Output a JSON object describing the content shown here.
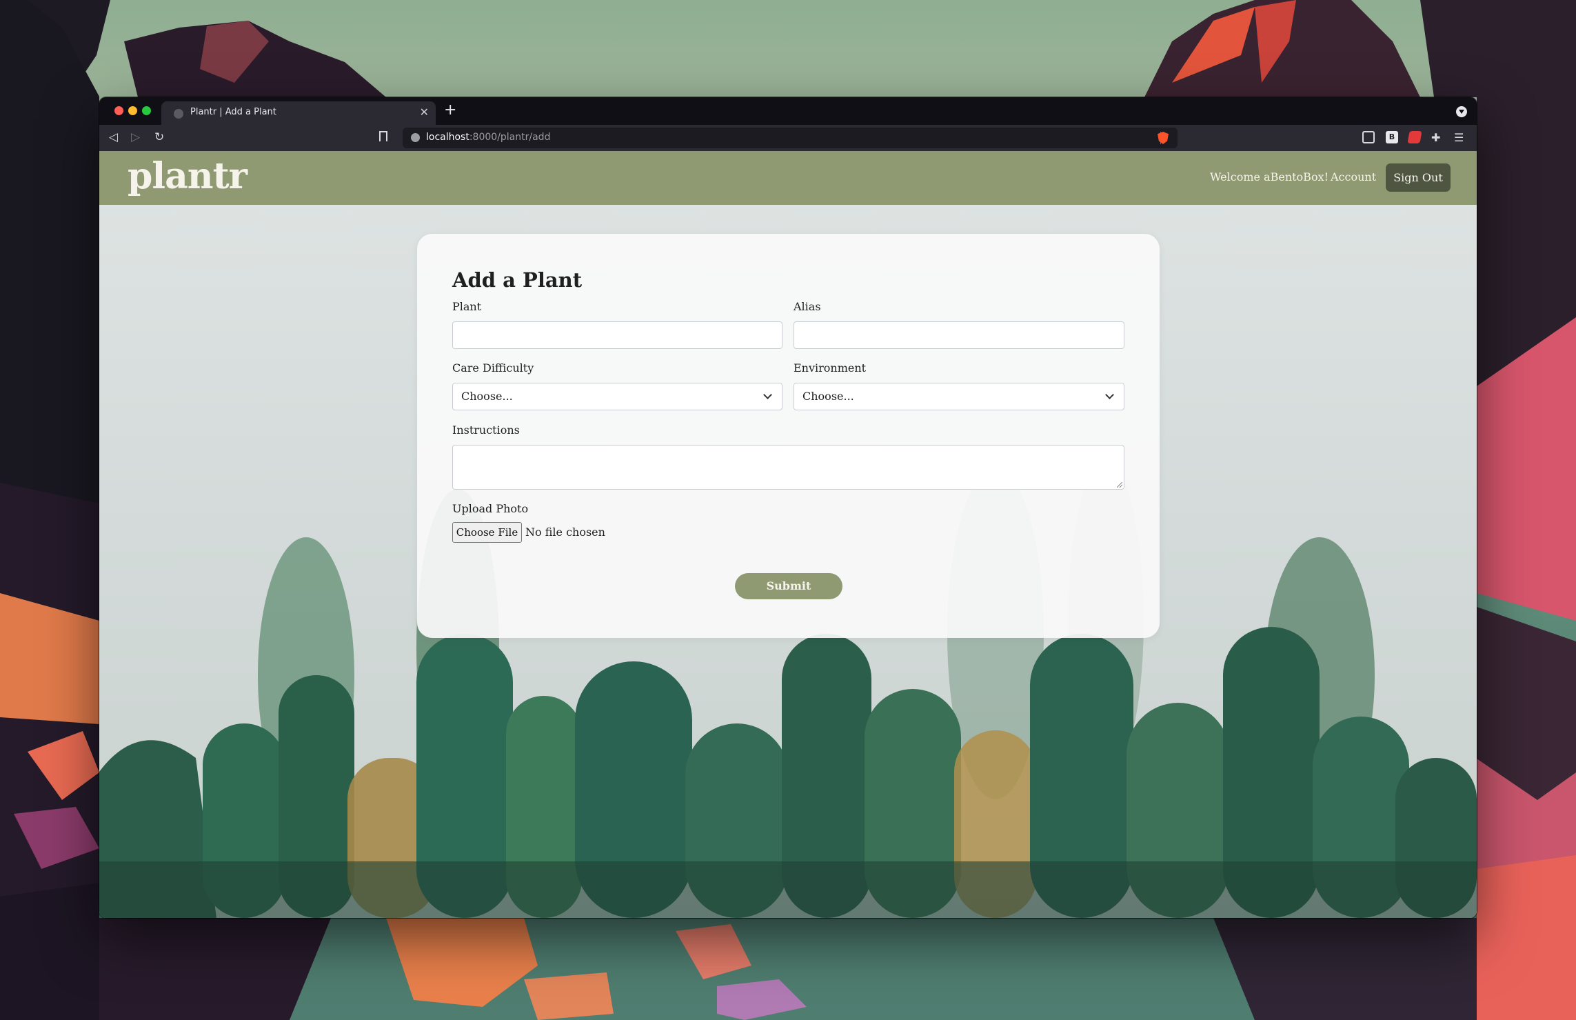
{
  "browser": {
    "tab_title": "Plantr | Add a Plant",
    "new_tab_label": "+",
    "url_host": "localhost",
    "url_path": ":8000/plantr/add",
    "extension_b_label": "B"
  },
  "navbar": {
    "brand": "plantr",
    "welcome": "Welcome aBentoBox!",
    "account": "Account",
    "sign_out": "Sign Out",
    "color": "#8f9a72"
  },
  "form": {
    "title": "Add a Plant",
    "plant_label": "Plant",
    "plant_value": "",
    "alias_label": "Alias",
    "alias_value": "",
    "care_difficulty_label": "Care Difficulty",
    "care_difficulty_value": "Choose...",
    "environment_label": "Environment",
    "environment_value": "Choose...",
    "instructions_label": "Instructions",
    "instructions_value": "",
    "upload_label": "Upload Photo",
    "choose_file_label": "Choose File",
    "file_status": "No file chosen",
    "submit_label": "Submit"
  }
}
